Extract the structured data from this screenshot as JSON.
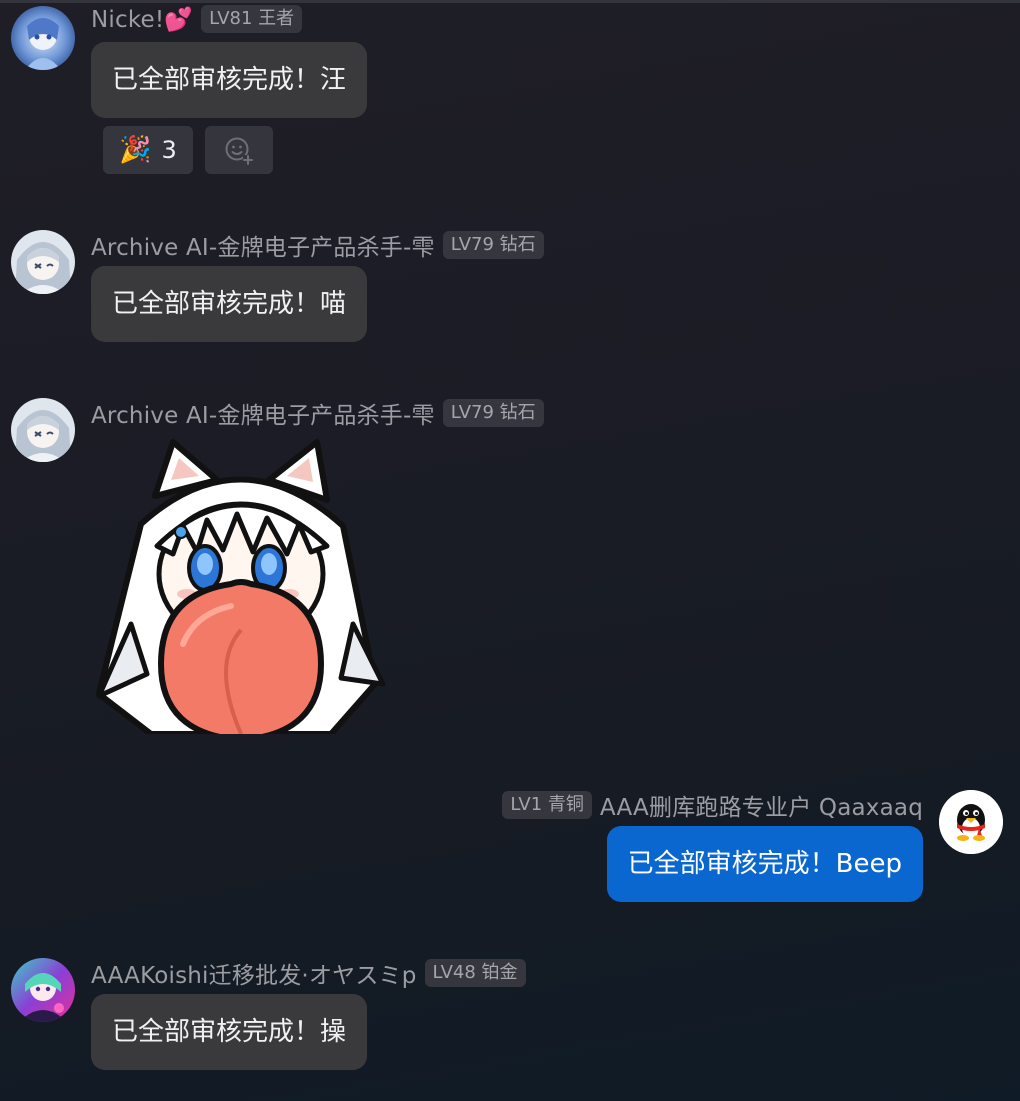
{
  "messages": [
    {
      "sender": "Nicke!💕",
      "level": "LV81 王者",
      "text": "已全部审核完成！汪",
      "reactions": [
        {
          "emoji": "🎉",
          "count": "3"
        }
      ]
    },
    {
      "sender": "Archive AI-金牌电子产品杀手-雫",
      "level": "LV79 钻石",
      "text": "已全部审核完成！喵"
    },
    {
      "sender": "Archive AI-金牌电子产品杀手-雫",
      "level": "LV79 钻石",
      "sticker": "white-haired-fox-girl-sticker"
    },
    {
      "sender": "AAA删库跑路专业户 Qaaxaaq",
      "level": "LV1 青铜",
      "text": "已全部审核完成！Beep",
      "self": true
    },
    {
      "sender": "AAAKoishi迁移批发·オヤスミp",
      "level": "LV48 铂金",
      "text": "已全部审核完成！操"
    }
  ],
  "colors": {
    "self_bubble": "#0b67d0",
    "other_bubble": "#3a3a3d",
    "badge_bg": "#35363e"
  },
  "icons": {
    "add_reaction": "emoji-add-icon",
    "self_avatar": "qq-penguin-avatar"
  }
}
